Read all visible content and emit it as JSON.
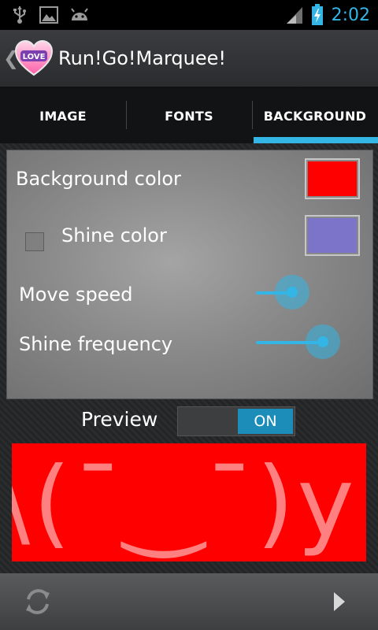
{
  "status_bar": {
    "time": "2:02",
    "icons": [
      "usb-icon",
      "image-icon",
      "android-icon",
      "signal-icon",
      "battery-icon"
    ]
  },
  "action_bar": {
    "title": "Run!Go!Marquee!",
    "logo_text": "LOVE"
  },
  "tabs": [
    {
      "label": "IMAGE",
      "active": false
    },
    {
      "label": "FONTS",
      "active": false
    },
    {
      "label": "BACKGROUND",
      "active": true
    }
  ],
  "settings": {
    "background_color": {
      "label": "Background color",
      "color": "#ff0000"
    },
    "shine_color": {
      "label": "Shine color",
      "color": "#7b74c9",
      "checked": false
    },
    "move_speed": {
      "label": "Move speed",
      "value": 0.37
    },
    "shine_frequency": {
      "label": "Shine frequency",
      "value": 0.74
    }
  },
  "preview": {
    "label": "Preview",
    "toggle_label": "ON",
    "marquee_text": "\\(¯‿¯)y",
    "background": "#ff0000"
  },
  "colors": {
    "accent": "#33b5e5"
  }
}
